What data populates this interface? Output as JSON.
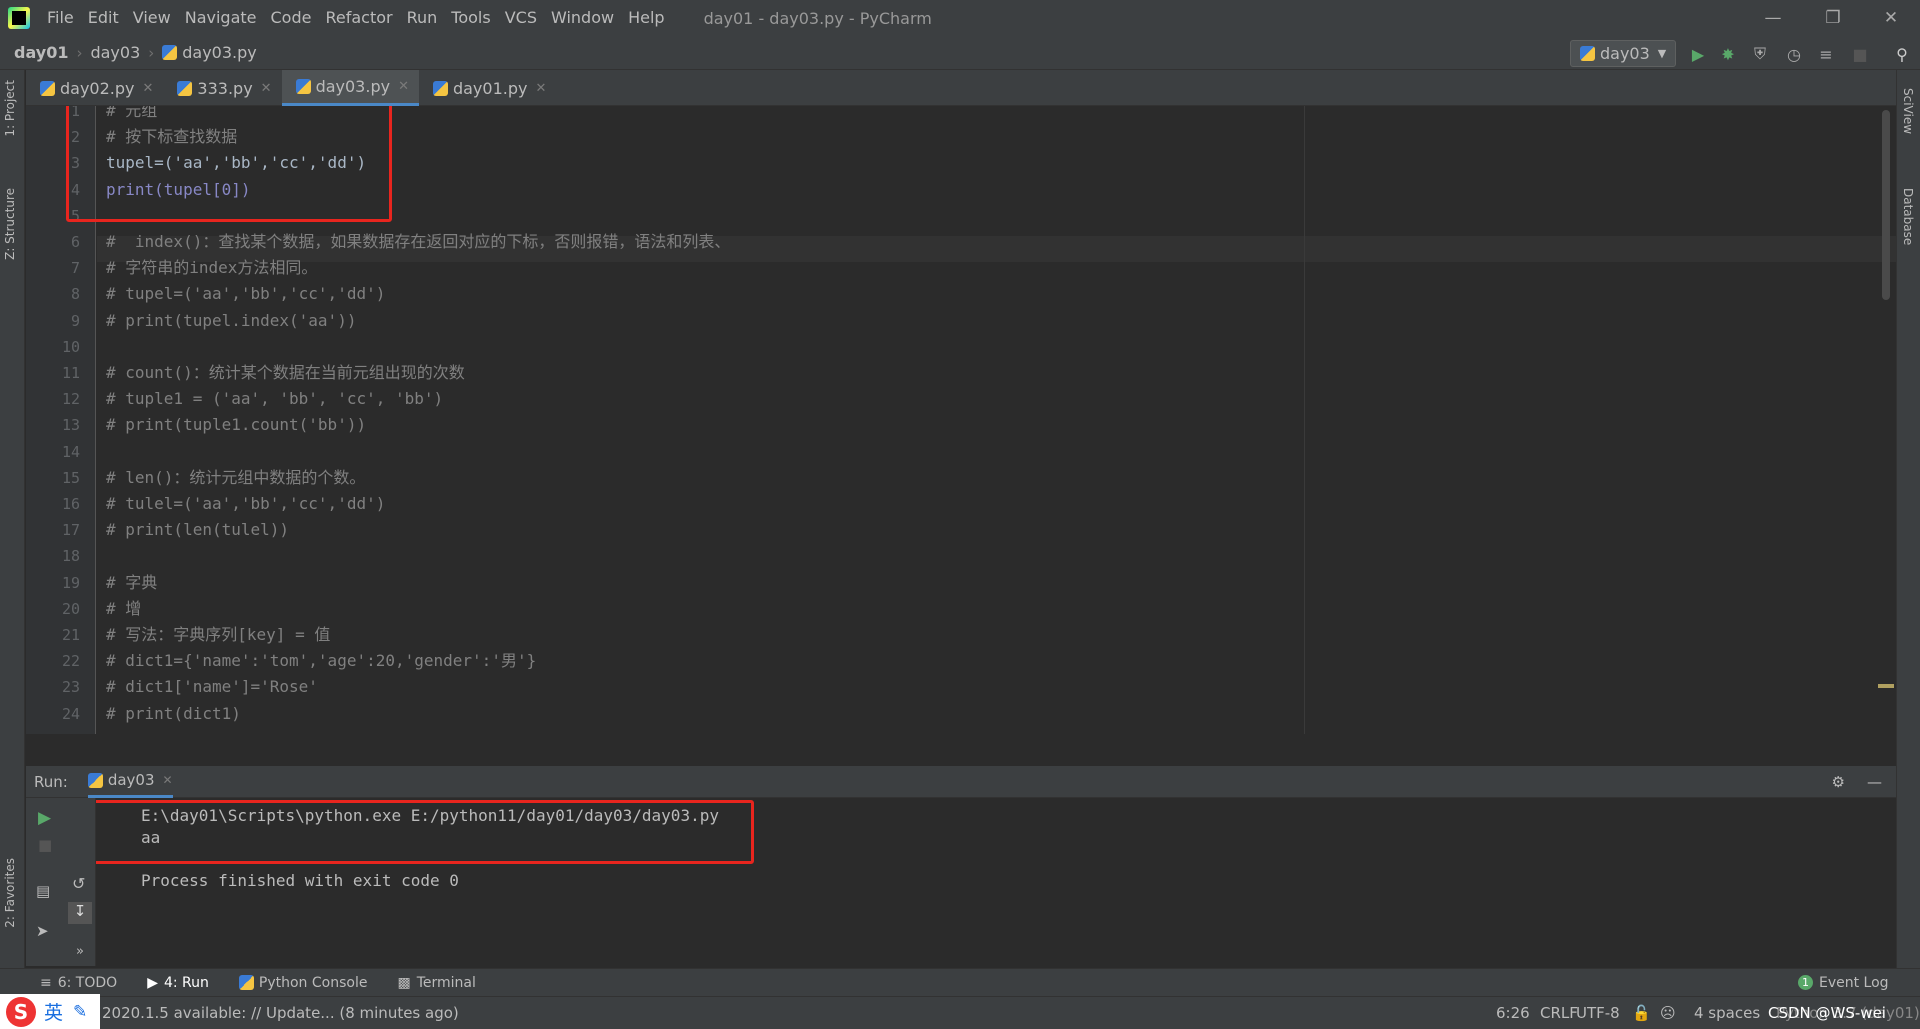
{
  "menu": [
    "File",
    "Edit",
    "View",
    "Navigate",
    "Code",
    "Refactor",
    "Run",
    "Tools",
    "VCS",
    "Window",
    "Help"
  ],
  "window_title": "day01 - day03.py - PyCharm",
  "breadcrumb": [
    "day01",
    "day03",
    "day03.py"
  ],
  "run_config": "day03",
  "left_tools": [
    "1: Project",
    "Z: Structure",
    "2: Favorites"
  ],
  "right_tools": [
    "SciView",
    "Database"
  ],
  "editor_tabs": [
    {
      "label": "day02.py",
      "active": false
    },
    {
      "label": "333.py",
      "active": false
    },
    {
      "label": "day03.py",
      "active": true
    },
    {
      "label": "day01.py",
      "active": false
    }
  ],
  "code_lines": [
    {
      "n": "1",
      "text": "# 元组"
    },
    {
      "n": "2",
      "text": "# 按下标查找数据"
    },
    {
      "n": "3",
      "text": "tupel=('aa','bb','cc','dd')"
    },
    {
      "n": "4",
      "text": "print(tupel[0])"
    },
    {
      "n": "5",
      "text": ""
    },
    {
      "n": "6",
      "text": "#  index()：查找某个数据，如果数据存在返回对应的下标，否则报错，语法和列表、"
    },
    {
      "n": "7",
      "text": "# 字符串的index方法相同。"
    },
    {
      "n": "8",
      "text": "# tupel=('aa','bb','cc','dd')"
    },
    {
      "n": "9",
      "text": "# print(tupel.index('aa'))"
    },
    {
      "n": "10",
      "text": ""
    },
    {
      "n": "11",
      "text": "# count()：统计某个数据在当前元组出现的次数"
    },
    {
      "n": "12",
      "text": "# tuple1 = ('aa', 'bb', 'cc', 'bb')"
    },
    {
      "n": "13",
      "text": "# print(tuple1.count('bb'))"
    },
    {
      "n": "14",
      "text": ""
    },
    {
      "n": "15",
      "text": "# len()：统计元组中数据的个数。"
    },
    {
      "n": "16",
      "text": "# tulel=('aa','bb','cc','dd')"
    },
    {
      "n": "17",
      "text": "# print(len(tulel))"
    },
    {
      "n": "18",
      "text": ""
    },
    {
      "n": "19",
      "text": "# 字典"
    },
    {
      "n": "20",
      "text": "# 增"
    },
    {
      "n": "21",
      "text": "# 写法：字典序列[key] = 值"
    },
    {
      "n": "22",
      "text": "# dict1={'name':'tom','age':20,'gender':'男'}"
    },
    {
      "n": "23",
      "text": "# dict1['name']='Rose'"
    },
    {
      "n": "24",
      "text": "# print(dict1)"
    }
  ],
  "run_panel": {
    "label": "Run:",
    "tab": "day03",
    "output": [
      "E:\\day01\\Scripts\\python.exe E:/python11/day01/day03/day03.py",
      "aa",
      "",
      "Process finished with exit code 0"
    ]
  },
  "bottom_tabs": [
    {
      "label": "6: TODO",
      "active": false
    },
    {
      "label": "4: Run",
      "active": true
    },
    {
      "label": "Python Console",
      "active": false
    },
    {
      "label": "Terminal",
      "active": false
    }
  ],
  "event_log": {
    "count": "1",
    "label": "Event Log"
  },
  "status": {
    "message": "2020.1.5 available: // Update... (8 minutes ago)",
    "position": "6:26",
    "line_sep": "CRLF",
    "encoding": "UTF-8",
    "indent": "4 spaces",
    "interpreter": "Python 3.7 (day01)",
    "watermark": "CSDN @WS-wei"
  },
  "ime": {
    "label": "英"
  }
}
